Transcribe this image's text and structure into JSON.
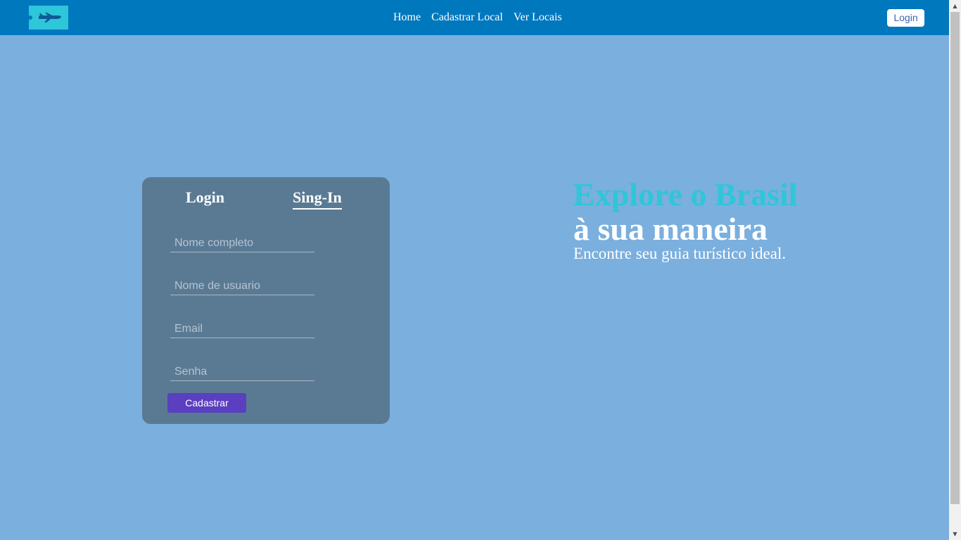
{
  "navbar": {
    "logo_icon": "airplane-icon",
    "links": [
      "Home",
      "Cadastrar Local",
      "Ver Locais"
    ],
    "login_label": "Login"
  },
  "form": {
    "tabs": {
      "login": "Login",
      "signin": "Sing-In"
    },
    "active_tab": "Sing-In",
    "fields": {
      "full_name_placeholder": "Nome completo",
      "username_placeholder": "Nome de usuario",
      "email_placeholder": "Email",
      "password_placeholder": "Senha"
    },
    "submit_label": "Cadastrar"
  },
  "hero": {
    "title": "Explore o Brasil",
    "subtitle": "à sua maneira",
    "text": "Encontre seu guia turístico ideal."
  },
  "colors": {
    "background": "#7aafde",
    "navbar": "#0078be",
    "accent": "#2ec6d9",
    "card": "#5a7a94",
    "button": "#5a3fc0"
  }
}
